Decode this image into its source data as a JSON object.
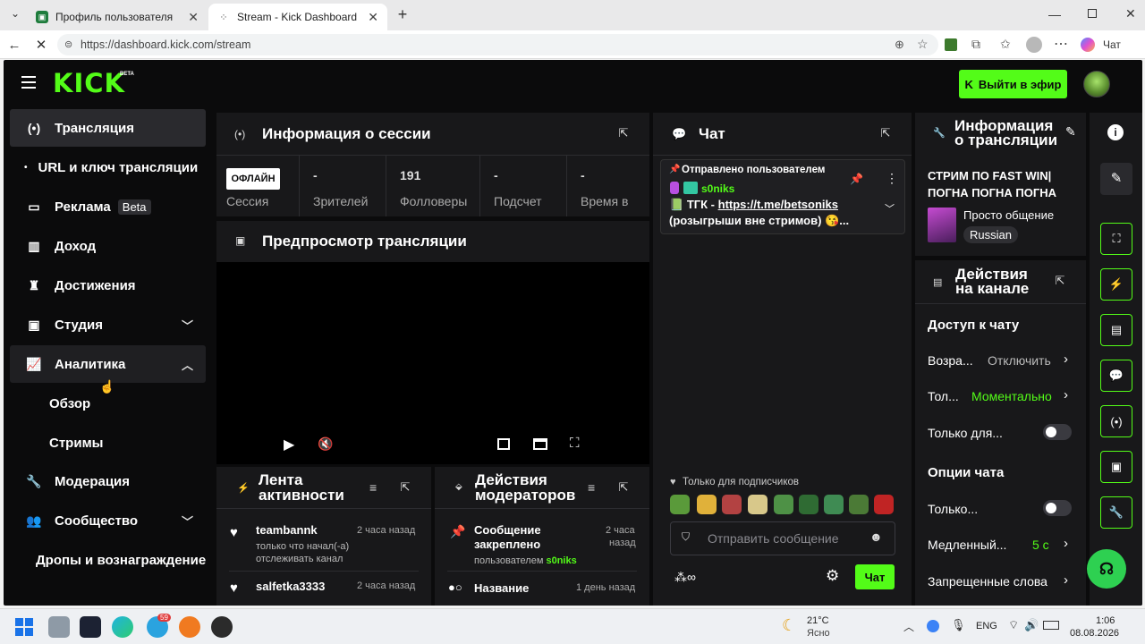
{
  "browser": {
    "tabs": [
      {
        "title": "Профиль пользователя",
        "active": false
      },
      {
        "title": "Stream - Kick Dashboard",
        "active": true
      }
    ],
    "url": "https://dashboard.kick.com/stream",
    "copilot_label": "Чат"
  },
  "header": {
    "logo": "KICK",
    "logo_badge": "BETA",
    "go_live_label": "Выйти в эфир"
  },
  "sidebar": {
    "items": [
      {
        "label": "Трансляция",
        "icon": "broadcast-icon",
        "active": true
      },
      {
        "label": "URL и ключ трансляции",
        "icon": "dot-icon"
      },
      {
        "label": "Реклама",
        "icon": "ad-icon",
        "badge": "Beta"
      },
      {
        "label": "Доход",
        "icon": "chart-icon"
      },
      {
        "label": "Достижения",
        "icon": "trophy-icon"
      },
      {
        "label": "Студия",
        "icon": "studio-icon",
        "expandable": true
      },
      {
        "label": "Аналитика",
        "icon": "analytics-icon",
        "expanded": true
      },
      {
        "label": "Обзор"
      },
      {
        "label": "Стримы"
      },
      {
        "label": "Модерация",
        "icon": "wrench-icon"
      },
      {
        "label": "Сообщество",
        "icon": "community-icon",
        "expandable": true
      },
      {
        "label": "Дропы и вознаграждение"
      }
    ]
  },
  "session": {
    "title": "Информация о сессии",
    "status": "ОФЛАЙН",
    "status_label": "Сессия",
    "stats": [
      {
        "value": "-",
        "label": "Зрителей"
      },
      {
        "value": "191",
        "label": "Фолловеры"
      },
      {
        "value": "-",
        "label": "Подсчет подписок"
      },
      {
        "value": "-",
        "label": "Время в прямом эфире"
      }
    ]
  },
  "preview": {
    "title": "Предпросмотр трансляции"
  },
  "activity": {
    "title_line1": "Лента",
    "title_line2": "активности",
    "items": [
      {
        "name": "teambannk",
        "time": "2 часа назад",
        "text_line1": "только что начал(-а)",
        "text_line2": "отслеживать канал"
      },
      {
        "name": "salfetka3333",
        "time": "2 часа назад"
      }
    ]
  },
  "mod_actions": {
    "title_line1": "Действия",
    "title_line2": "модераторов",
    "items": [
      {
        "title_line1": "Сообщение",
        "title_line2": "закреплено",
        "time_line1": "2 часа",
        "time_line2": "назад",
        "by": "пользователем",
        "user": "s0niks"
      },
      {
        "title_line1": "Название",
        "time_line1": "1 день назад"
      }
    ]
  },
  "chat": {
    "title": "Чат",
    "pinned_header": "Отправлено пользователем",
    "pinned_user": "s0niks",
    "pinned_text_prefix": "ТГК - ",
    "pinned_link": "https://t.me/betsoniks",
    "pinned_text_suffix": "(розыгрыши вне стримов) 😘...",
    "subscribers_only": "Только для подписчиков",
    "input_placeholder": "Отправить сообщение",
    "send_label": "Чат"
  },
  "stream_info": {
    "title_line1": "Информация",
    "title_line2": "о трансляции",
    "stream_title_line1": "СТРИМ ПО FAST WIN|",
    "stream_title_line2": "ПОГНА ПОГНА ПОГНА",
    "category": "Просто общение",
    "language": "Russian"
  },
  "channel_actions": {
    "title_line1": "Действия",
    "title_line2": "на канале",
    "chat_access_header": "Доступ к чату",
    "rows": [
      {
        "label": "Возра...",
        "value": "Отключить"
      },
      {
        "label": "Тол...",
        "value": "Моментально"
      },
      {
        "label": "Только для...",
        "toggle": false
      }
    ],
    "chat_options_header": "Опции чата",
    "options": [
      {
        "label": "Только...",
        "toggle": false
      },
      {
        "label": "Медленный...",
        "value": "5 с"
      },
      {
        "label": "Запрещенные слова"
      }
    ]
  },
  "colors": {
    "accent": "#53fc18",
    "panel": "#18181a",
    "bg": "#0b0b0c"
  },
  "taskbar": {
    "weather_temp": "21°C",
    "weather_desc": "Ясно",
    "lang": "ENG",
    "time": "1:06",
    "date": "08.08.2026",
    "telegram_badge": "59"
  }
}
